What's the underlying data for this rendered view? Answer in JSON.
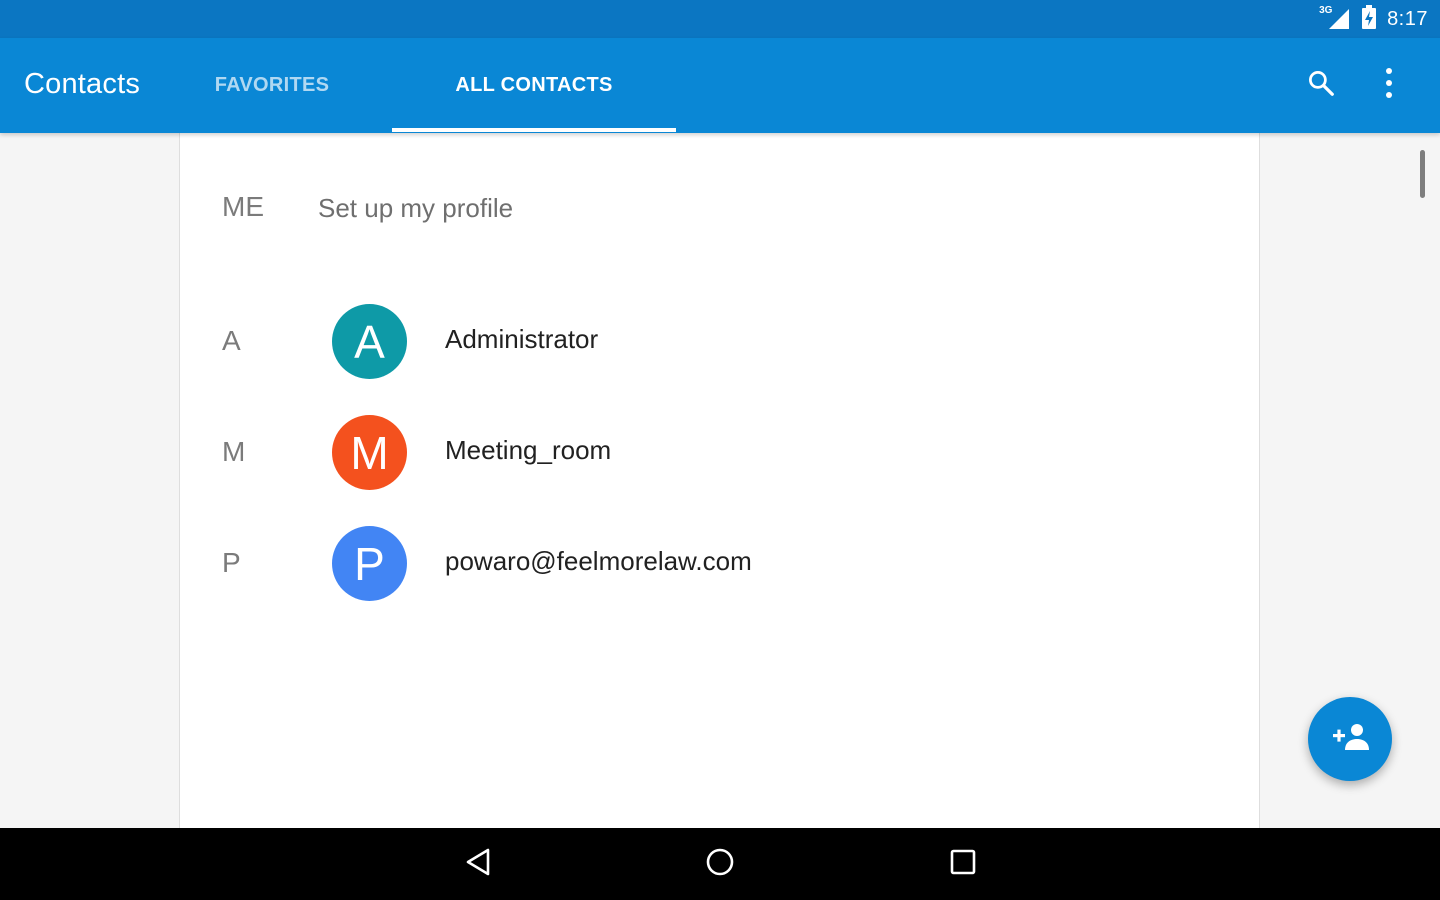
{
  "status_bar": {
    "network_type": "3G",
    "time": "8:17"
  },
  "app_bar": {
    "title": "Contacts",
    "tabs": [
      {
        "label": "FAVORITES",
        "selected": false
      },
      {
        "label": "ALL CONTACTS",
        "selected": true
      }
    ],
    "actions": [
      "search-icon",
      "more-vert-icon"
    ]
  },
  "profile": {
    "section_label": "ME",
    "text": "Set up my profile"
  },
  "contacts": [
    {
      "section": "A",
      "initial": "A",
      "name": "Administrator",
      "color": "#0e9aa7"
    },
    {
      "section": "M",
      "initial": "M",
      "name": "Meeting_room",
      "color": "#f4511e"
    },
    {
      "section": "P",
      "initial": "P",
      "name": "powaro@feelmorelaw.com",
      "color": "#4285f4"
    }
  ],
  "fab": {
    "icon": "add-person-icon"
  },
  "nav_bar": {
    "buttons": [
      "back-icon",
      "home-icon",
      "recents-icon"
    ]
  },
  "colors": {
    "status_bar": "#0b76c2",
    "app_bar": "#0a87d5",
    "background": "#f5f5f5"
  }
}
